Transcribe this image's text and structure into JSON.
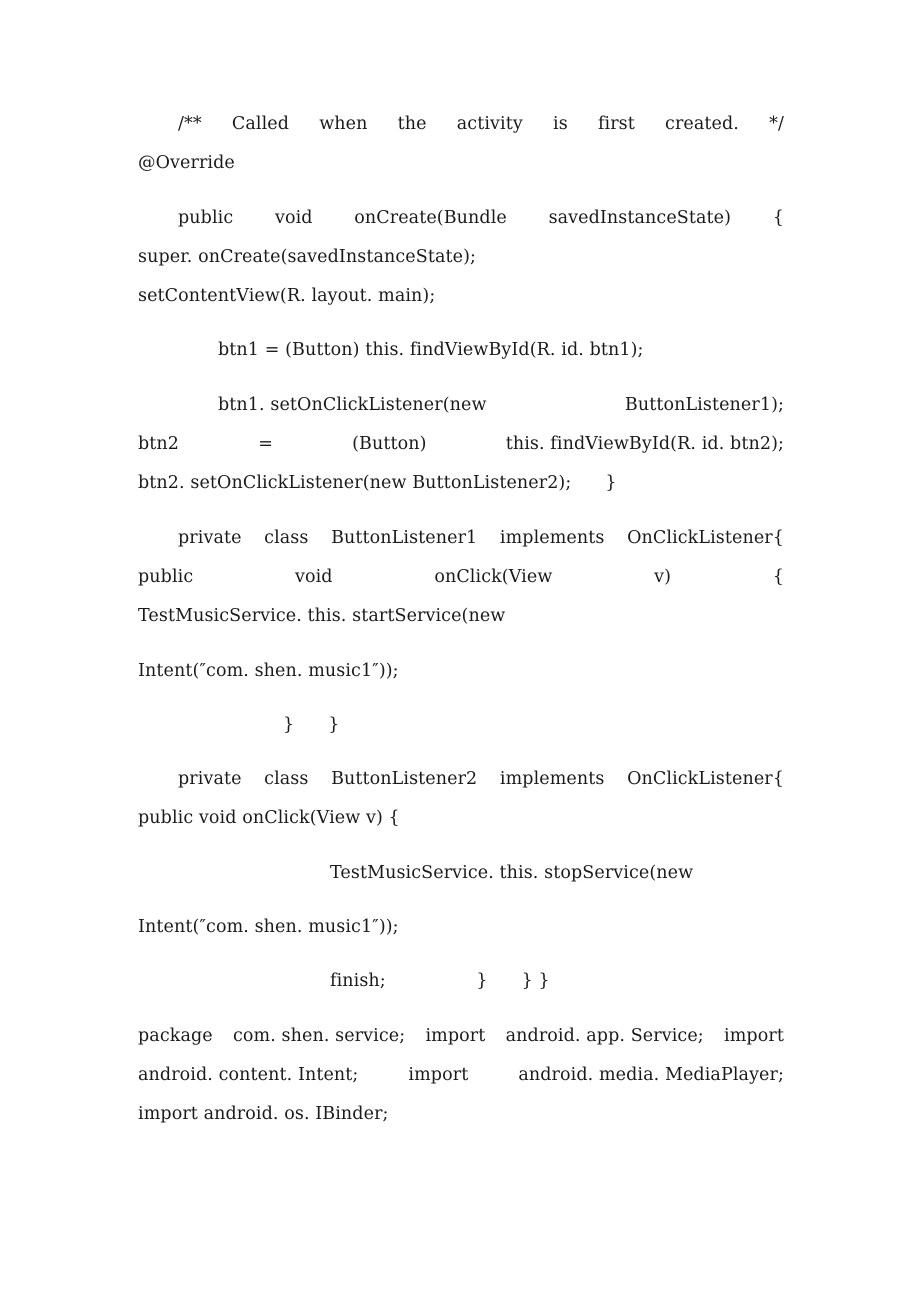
{
  "document": {
    "page_background": "#ffffff",
    "text_color": "#1a1a1a",
    "blocks": [
      {
        "id": "comment_override",
        "lines": [
          {
            "id": "l1",
            "type": "justified",
            "indent": 1,
            "segments": [
              "/**",
              "Called",
              "when",
              "the",
              "activity",
              "is",
              "first",
              "created.",
              "*/"
            ]
          },
          {
            "id": "l2",
            "type": "plain",
            "indent": 0,
            "text": "@Override"
          }
        ]
      },
      {
        "id": "oncreate",
        "lines": [
          {
            "id": "l3",
            "type": "justified",
            "indent": 1,
            "segments": [
              "public",
              "void",
              "onCreate(Bundle",
              "savedInstanceState)",
              "{"
            ]
          },
          {
            "id": "l4",
            "type": "plain",
            "indent": 0,
            "text": "super. onCreate(savedInstanceState);"
          },
          {
            "id": "l5",
            "type": "plain",
            "indent": 0,
            "text": "setContentView(R. layout. main);"
          }
        ]
      },
      {
        "id": "btn1_init",
        "lines": [
          {
            "id": "l6",
            "type": "plain",
            "indent": 2,
            "text": "btn1 = (Button) this. findViewById(R. id. btn1);"
          }
        ]
      },
      {
        "id": "btn1_listener",
        "lines": [
          {
            "id": "l7",
            "type": "justified",
            "indent": 2,
            "segments": [
              "btn1. setOnClickListener(new",
              "ButtonListener1);"
            ]
          },
          {
            "id": "l8",
            "type": "justified",
            "indent": 0,
            "segments": [
              "btn2",
              "=",
              "(Button)",
              "this. findViewById(R. id. btn2);"
            ]
          },
          {
            "id": "l9",
            "type": "plain",
            "indent": 0,
            "text": "btn2. setOnClickListener(new ButtonListener2);      }"
          }
        ]
      },
      {
        "id": "listener1_class",
        "lines": [
          {
            "id": "l10",
            "type": "justified",
            "indent": 1,
            "segments": [
              "private",
              "class",
              "ButtonListener1",
              "implements",
              "OnClickListener{"
            ]
          },
          {
            "id": "l11",
            "type": "justified",
            "indent": 0,
            "segments": [
              "public",
              "void",
              "onClick(View",
              "v)",
              "{"
            ]
          },
          {
            "id": "l12",
            "type": "plain",
            "indent": 0,
            "text": "TestMusicService. this. startService(new"
          }
        ]
      },
      {
        "id": "listener1_intent",
        "lines": [
          {
            "id": "l13",
            "type": "plain",
            "indent": 0,
            "text": "Intent(″com. shen. music1″));"
          }
        ]
      },
      {
        "id": "listener1_close",
        "lines": [
          {
            "id": "l14",
            "type": "plain",
            "indent": 3,
            "text": "}      }"
          }
        ]
      },
      {
        "id": "listener2_class",
        "lines": [
          {
            "id": "l15",
            "type": "justified",
            "indent": 1,
            "segments": [
              "private",
              "class",
              "ButtonListener2",
              "implements",
              "OnClickListener{"
            ]
          },
          {
            "id": "l16",
            "type": "plain",
            "indent": 0,
            "text": "public void onClick(View v) {"
          }
        ]
      },
      {
        "id": "listener2_stop",
        "lines": [
          {
            "id": "l17",
            "type": "plain",
            "indent": 4,
            "text": "TestMusicService. this. stopService(new"
          }
        ]
      },
      {
        "id": "listener2_intent",
        "lines": [
          {
            "id": "l18",
            "type": "plain",
            "indent": 0,
            "text": "Intent(″com. shen. music1″));"
          }
        ]
      },
      {
        "id": "listener2_close",
        "lines": [
          {
            "id": "l19",
            "type": "plain",
            "indent": 4,
            "text": "finish;                }      } }"
          }
        ]
      },
      {
        "id": "package_imports",
        "lines": [
          {
            "id": "l20",
            "type": "justified",
            "indent": 0,
            "segments": [
              "package",
              "com. shen. service;",
              "import",
              "android. app. Service;",
              "import"
            ]
          },
          {
            "id": "l21",
            "type": "justified",
            "indent": 0,
            "segments": [
              "android. content. Intent;",
              "import",
              "android. media. MediaPlayer;"
            ]
          },
          {
            "id": "l22",
            "type": "plain",
            "indent": 0,
            "text": "import android. os. IBinder;"
          }
        ]
      }
    ]
  }
}
